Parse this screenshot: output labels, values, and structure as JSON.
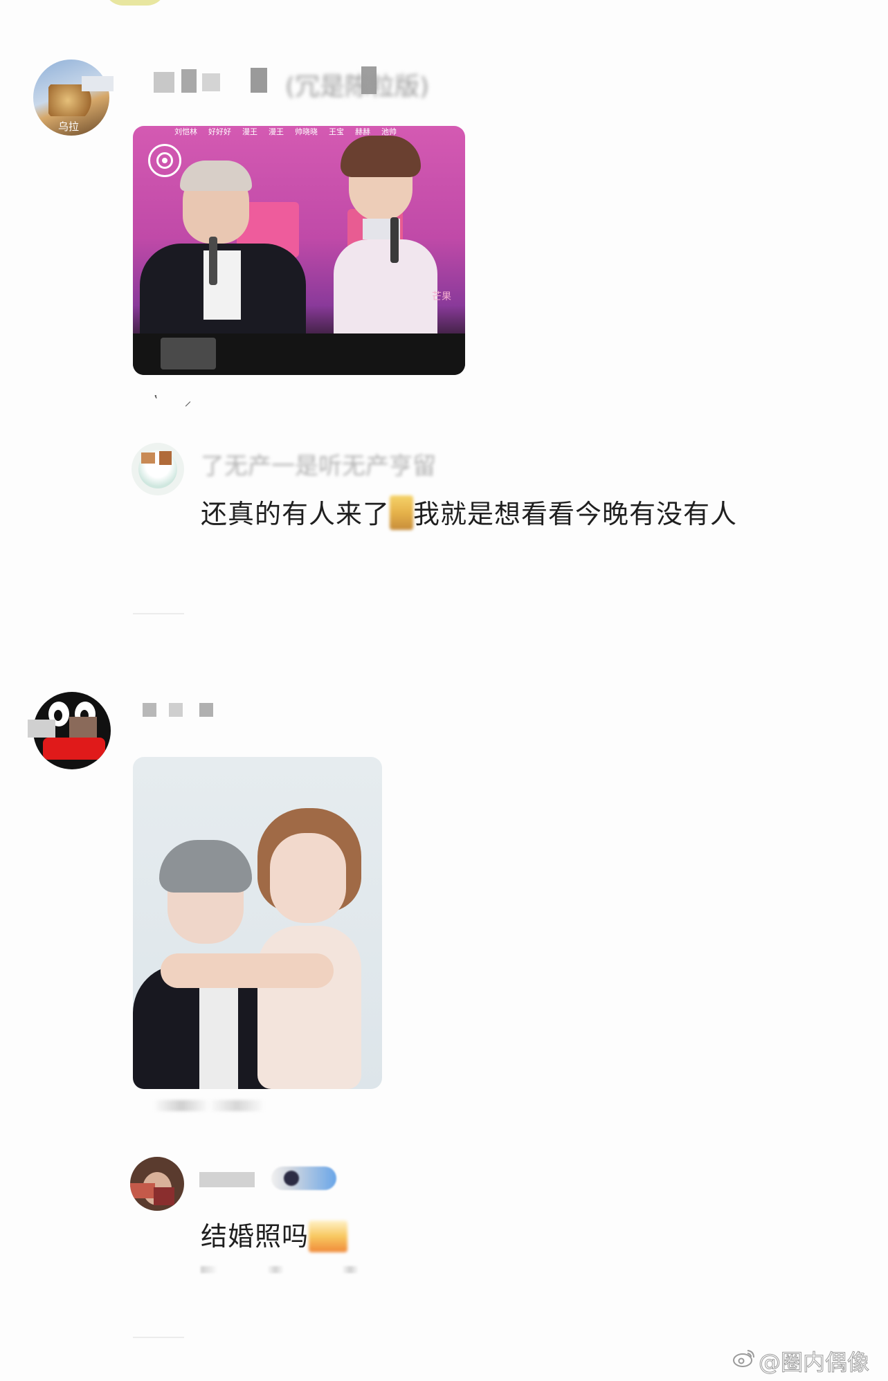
{
  "thread1": {
    "author": {
      "name": "(冗是陈粒版)",
      "avatar_icon": "anime-avatar-icon",
      "avatar_badge": "乌拉"
    },
    "image": {
      "name_tags": [
        "刘恺林",
        "好好好",
        "漫王",
        "漫王",
        "帅晓晓",
        "王宝",
        "赫赫",
        "池帅"
      ],
      "corner_mark": "芒果"
    },
    "reply": {
      "name": "了无产一是听无产亨留",
      "text_before": "还真的有人来了",
      "text_after": "我就是想看看今晚有没有人",
      "emoji_icon": "blurred-emoji-icon"
    }
  },
  "thread2": {
    "author": {
      "avatar_icon": "penguin-avatar-icon"
    },
    "reply": {
      "text": "结婚照吗",
      "emoji_icon": "blurred-emoji-icon"
    }
  },
  "watermark": {
    "icon": "weibo-icon",
    "text": "@圈内偶像"
  },
  "colors": {
    "background": "#fdfdfd",
    "stage_pink": "#c04aa8",
    "divider": "#ececec"
  }
}
